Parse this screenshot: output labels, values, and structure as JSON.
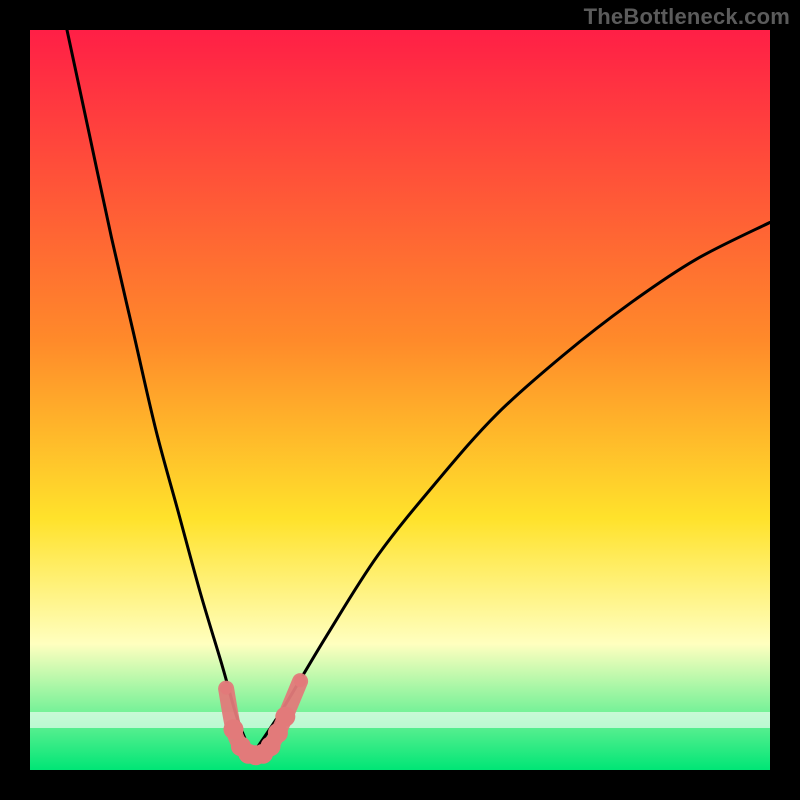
{
  "watermark": "TheBottleneck.com",
  "colors": {
    "gradient_top": "#ff1f46",
    "gradient_mid1": "#ff8a2a",
    "gradient_mid2": "#ffe22b",
    "gradient_mid3": "#ffffbf",
    "gradient_bottom": "#00e676",
    "curve": "#000000",
    "marker_fill": "#e27a7a",
    "marker_stroke": "#b85a5a",
    "white_band": "#ffffff"
  },
  "chart_data": {
    "type": "line",
    "title": "",
    "xlabel": "",
    "ylabel": "",
    "xlim": [
      0,
      100
    ],
    "ylim": [
      0,
      100
    ],
    "grid": false,
    "legend": false,
    "notes": "V-shaped bottleneck curve on a red→yellow→green vertical gradient. Left branch starts near top-left and descends to a minimum around x≈30; right branch rises smoothly toward the upper-right. Pink rounded markers sit along the bottom of the V near the minimum.",
    "series": [
      {
        "name": "left_branch",
        "x": [
          5,
          8,
          11,
          14,
          17,
          20,
          23,
          26,
          28,
          30
        ],
        "y": [
          100,
          86,
          72,
          59,
          46,
          35,
          24,
          14,
          7,
          2
        ]
      },
      {
        "name": "right_branch",
        "x": [
          30,
          34,
          40,
          47,
          55,
          63,
          72,
          81,
          90,
          100
        ],
        "y": [
          2,
          8,
          18,
          29,
          39,
          48,
          56,
          63,
          69,
          74
        ]
      }
    ],
    "markers": {
      "name": "near_minimum_points",
      "x": [
        26.5,
        27.5,
        28.5,
        29.5,
        30.5,
        31.5,
        32.5,
        33.5,
        34.5,
        36.5
      ],
      "y": [
        11,
        5.5,
        3.2,
        2.2,
        2.0,
        2.2,
        3.2,
        5.0,
        7.2,
        12
      ]
    }
  }
}
